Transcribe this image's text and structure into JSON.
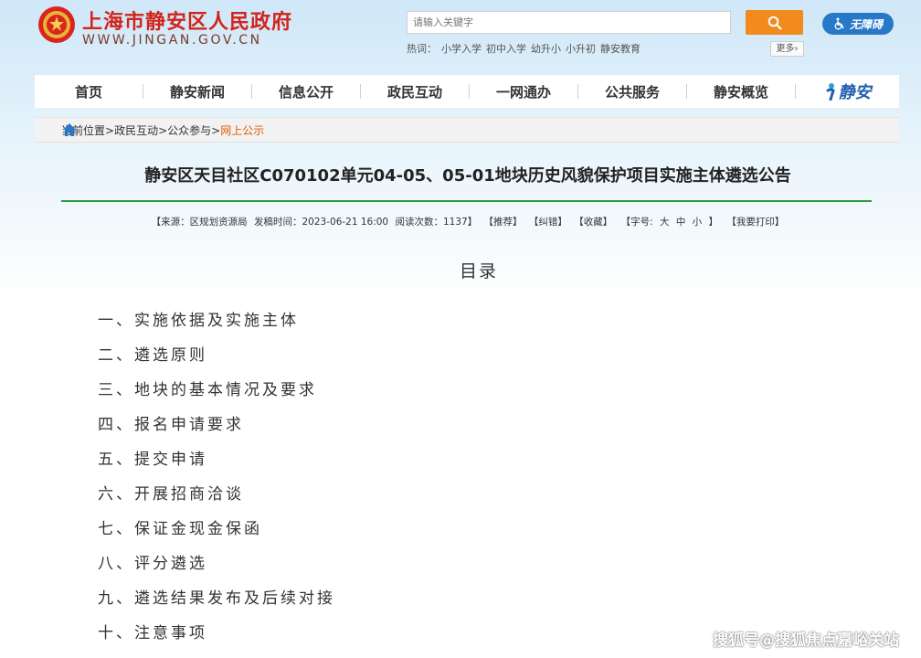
{
  "header": {
    "site_title": "上海市静安区人民政府",
    "site_url": "WWW.JINGAN.GOV.CN",
    "search_placeholder": "请输入关键字",
    "accessibility_label": "无障碍",
    "hot_words_label": "热词：",
    "hot_words": [
      "小学入学",
      "初中入学",
      "幼升小",
      "小升初",
      "静安教育"
    ],
    "more_label": "更多"
  },
  "nav": {
    "items": [
      "首页",
      "静安新闻",
      "信息公开",
      "政民互动",
      "一网通办",
      "公共服务",
      "静安概览"
    ],
    "logo_text": "静安"
  },
  "breadcrumb": {
    "items": [
      "当前位置>",
      "政民互动>",
      "公众参与>"
    ],
    "current": "网上公示"
  },
  "article": {
    "title": "静安区天目社区C070102单元04-05、05-01地块历史风貌保护项目实施主体遴选公告",
    "source": "【来源：区规划资源局",
    "publish_time": "发稿时间：2023-06-21 16:00",
    "views": "阅读次数：1137】",
    "actions": [
      "【推荐】",
      "【纠错】",
      "【收藏】"
    ],
    "font_size_label": "【字号:",
    "font_sizes": [
      "大",
      "中",
      "小"
    ],
    "font_size_close": "】",
    "print_label": "【我要打印】",
    "toc_heading": "目录",
    "toc": [
      "一、实施依据及实施主体",
      "二、遴选原则",
      "三、地块的基本情况及要求",
      "四、报名申请要求",
      "五、提交申请",
      "六、开展招商洽谈",
      "七、保证金现金保函",
      "八、评分遴选",
      "九、遴选结果发布及后续对接",
      "十、注意事项"
    ]
  },
  "watermark": "搜狐号@搜狐焦点嘉峪关站",
  "colors": {
    "title_red": "#d3231c",
    "search_orange": "#f28a1d",
    "accessibility_blue": "#2878c8",
    "rule_green": "#2f9a3e",
    "breadcrumb_current": "#e05a00"
  }
}
